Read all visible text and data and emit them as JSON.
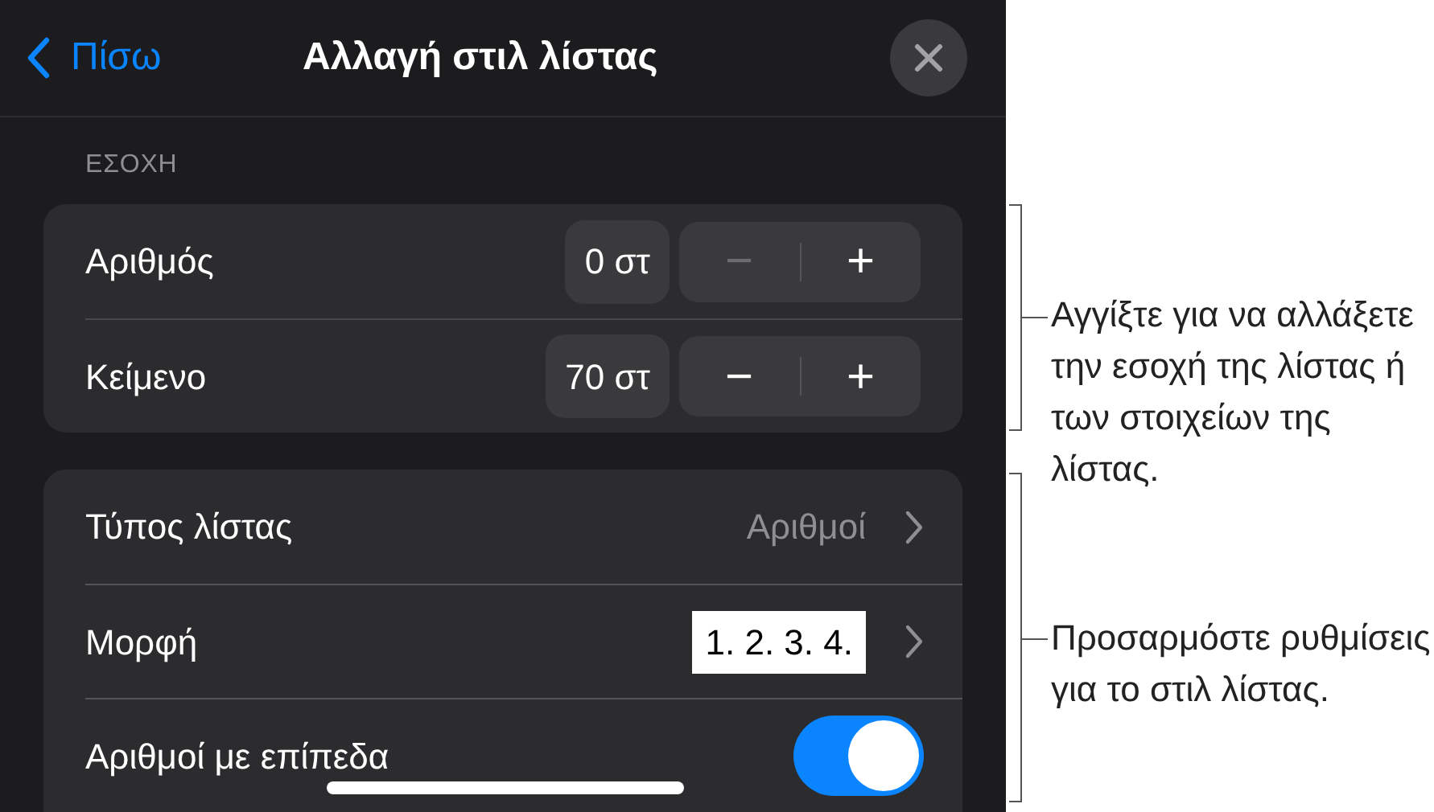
{
  "header": {
    "back": "Πίσω",
    "title": "Αλλαγή στιλ λίστας"
  },
  "indent": {
    "label": "ΕΣΟΧΗ",
    "rows": [
      {
        "label": "Αριθμός",
        "value": "0 στ",
        "minus": "−",
        "plus": "+",
        "minus_disabled": true
      },
      {
        "label": "Κείμενο",
        "value": "70 στ",
        "minus": "−",
        "plus": "+",
        "minus_disabled": false
      }
    ]
  },
  "options": [
    {
      "kind": "value",
      "label": "Τύπος λίστας",
      "value": "Αριθμοί"
    },
    {
      "kind": "format",
      "label": "Μορφή",
      "value": "1. 2. 3. 4."
    },
    {
      "kind": "toggle",
      "label": "Αριθμοί με επίπεδα",
      "on": true
    }
  ],
  "callouts": [
    "Αγγίξτε για να αλλάξετε την εσοχή της λίστας ή των στοιχείων της λίστας.",
    "Προσαρμόστε ρυθμίσεις για το στιλ λίστας."
  ]
}
